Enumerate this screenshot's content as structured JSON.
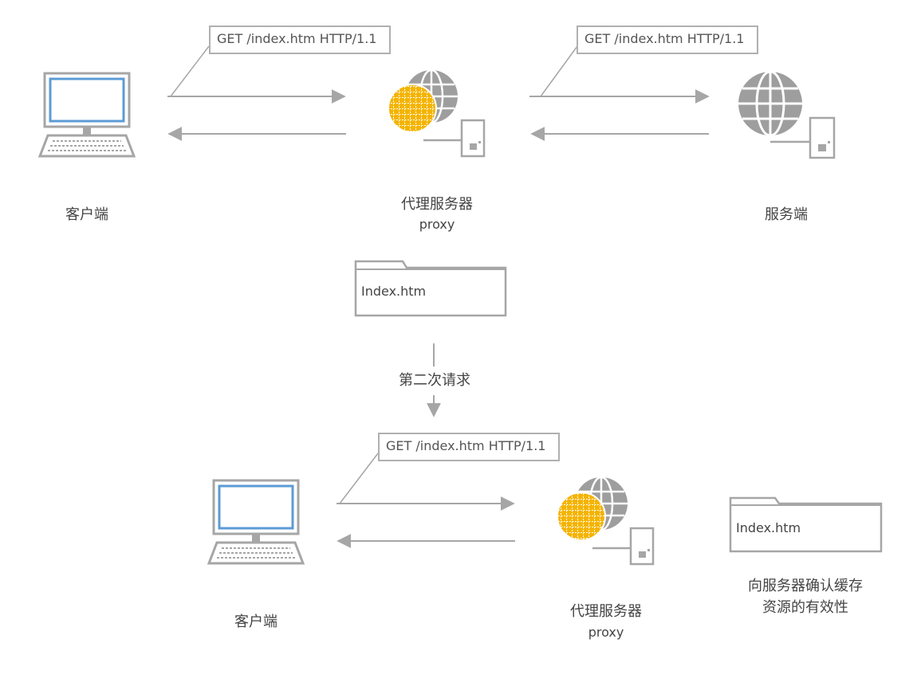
{
  "colors": {
    "line": "#a6a6a6",
    "screen_blue": "#5b9bd5",
    "globe_gray": "#9e9e9e",
    "globe_yellow": "#f4b400",
    "text": "#444444"
  },
  "top_request_1": "GET /index.htm HTTP/1.1",
  "top_request_2": "GET /index.htm HTTP/1.1",
  "bottom_request": "GET /index.htm HTTP/1.1",
  "labels": {
    "client_top": "客户端",
    "proxy_top": "代理服务器",
    "proxy_top_sub": "proxy",
    "server": "服务端",
    "client_bottom": "客户端",
    "proxy_bottom": "代理服务器",
    "proxy_bottom_sub": "proxy"
  },
  "cache_file_top": "Index.htm",
  "cache_file_bottom": "Index.htm",
  "second_request": "第二次请求",
  "validate_caption_line1": "向服务器确认缓存",
  "validate_caption_line2": "资源的有效性"
}
